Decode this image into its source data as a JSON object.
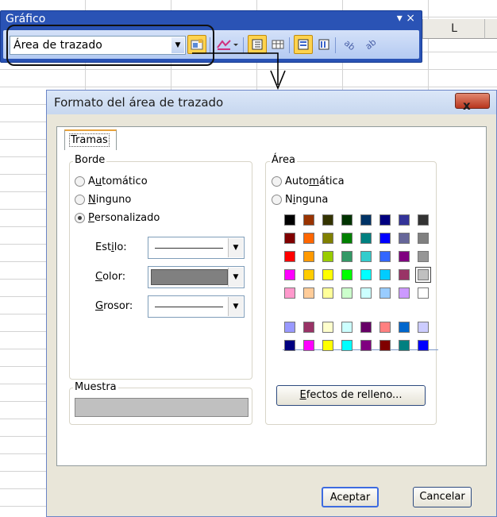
{
  "toolbar": {
    "title": "Gráfico",
    "controls": "▾ ×",
    "combo_value": "Área de trazado"
  },
  "sheet": {
    "column_label": "L"
  },
  "dialog": {
    "title": "Formato del área de trazado",
    "close_label": "x",
    "tab_label": "Tramas",
    "border": {
      "heading": "Borde",
      "options": [
        {
          "pre": "A",
          "u": "u",
          "post": "tomático",
          "checked": false
        },
        {
          "pre": "",
          "u": "N",
          "post": "inguno",
          "checked": false
        },
        {
          "pre": "",
          "u": "P",
          "post": "ersonalizado",
          "checked": true
        }
      ],
      "style_label_pre": "Est",
      "style_label_u": "i",
      "style_label_post": "lo:",
      "color_label_pre": "",
      "color_label_u": "C",
      "color_label_post": "olor:",
      "weight_label_pre": "",
      "weight_label_u": "G",
      "weight_label_post": "rosor:",
      "color_value": "#808080"
    },
    "sample": {
      "heading": "Muestra",
      "color": "#c0c0c0"
    },
    "area": {
      "heading": "Área",
      "options": [
        {
          "pre": "Auto",
          "u": "m",
          "post": "ática",
          "checked": false
        },
        {
          "pre": "N",
          "u": "i",
          "post": "nguna",
          "checked": false
        }
      ],
      "palette_top": [
        [
          "#000000",
          "#993300",
          "#333300",
          "#003300",
          "#003366",
          "#000080",
          "#333399",
          "#333333"
        ],
        [
          "#800000",
          "#FF6600",
          "#808000",
          "#008000",
          "#008080",
          "#0000FF",
          "#666699",
          "#808080"
        ],
        [
          "#FF0000",
          "#FF9900",
          "#99CC00",
          "#339966",
          "#33CCCC",
          "#3366FF",
          "#800080",
          "#969696"
        ],
        [
          "#FF00FF",
          "#FFCC00",
          "#FFFF00",
          "#00FF00",
          "#00FFFF",
          "#00CCFF",
          "#993366",
          "#C0C0C0"
        ],
        [
          "#FF99CC",
          "#FFCC99",
          "#FFFF99",
          "#CCFFCC",
          "#CCFFFF",
          "#99CCFF",
          "#CC99FF",
          "#FFFFFF"
        ]
      ],
      "selected_color": "#C0C0C0",
      "palette_bottom": [
        [
          "#9999FF",
          "#993366",
          "#FFFFCC",
          "#CCFFFF",
          "#660066",
          "#FF8080",
          "#0066CC",
          "#CCCCFF"
        ],
        [
          "#000080",
          "#FF00FF",
          "#FFFF00",
          "#00FFFF",
          "#800080",
          "#800000",
          "#008080",
          "#0000FF"
        ]
      ],
      "fill_effects_pre": "",
      "fill_effects_u": "E",
      "fill_effects_post": "fectos de relleno..."
    },
    "ok_label": "Aceptar",
    "cancel_label": "Cancelar"
  }
}
